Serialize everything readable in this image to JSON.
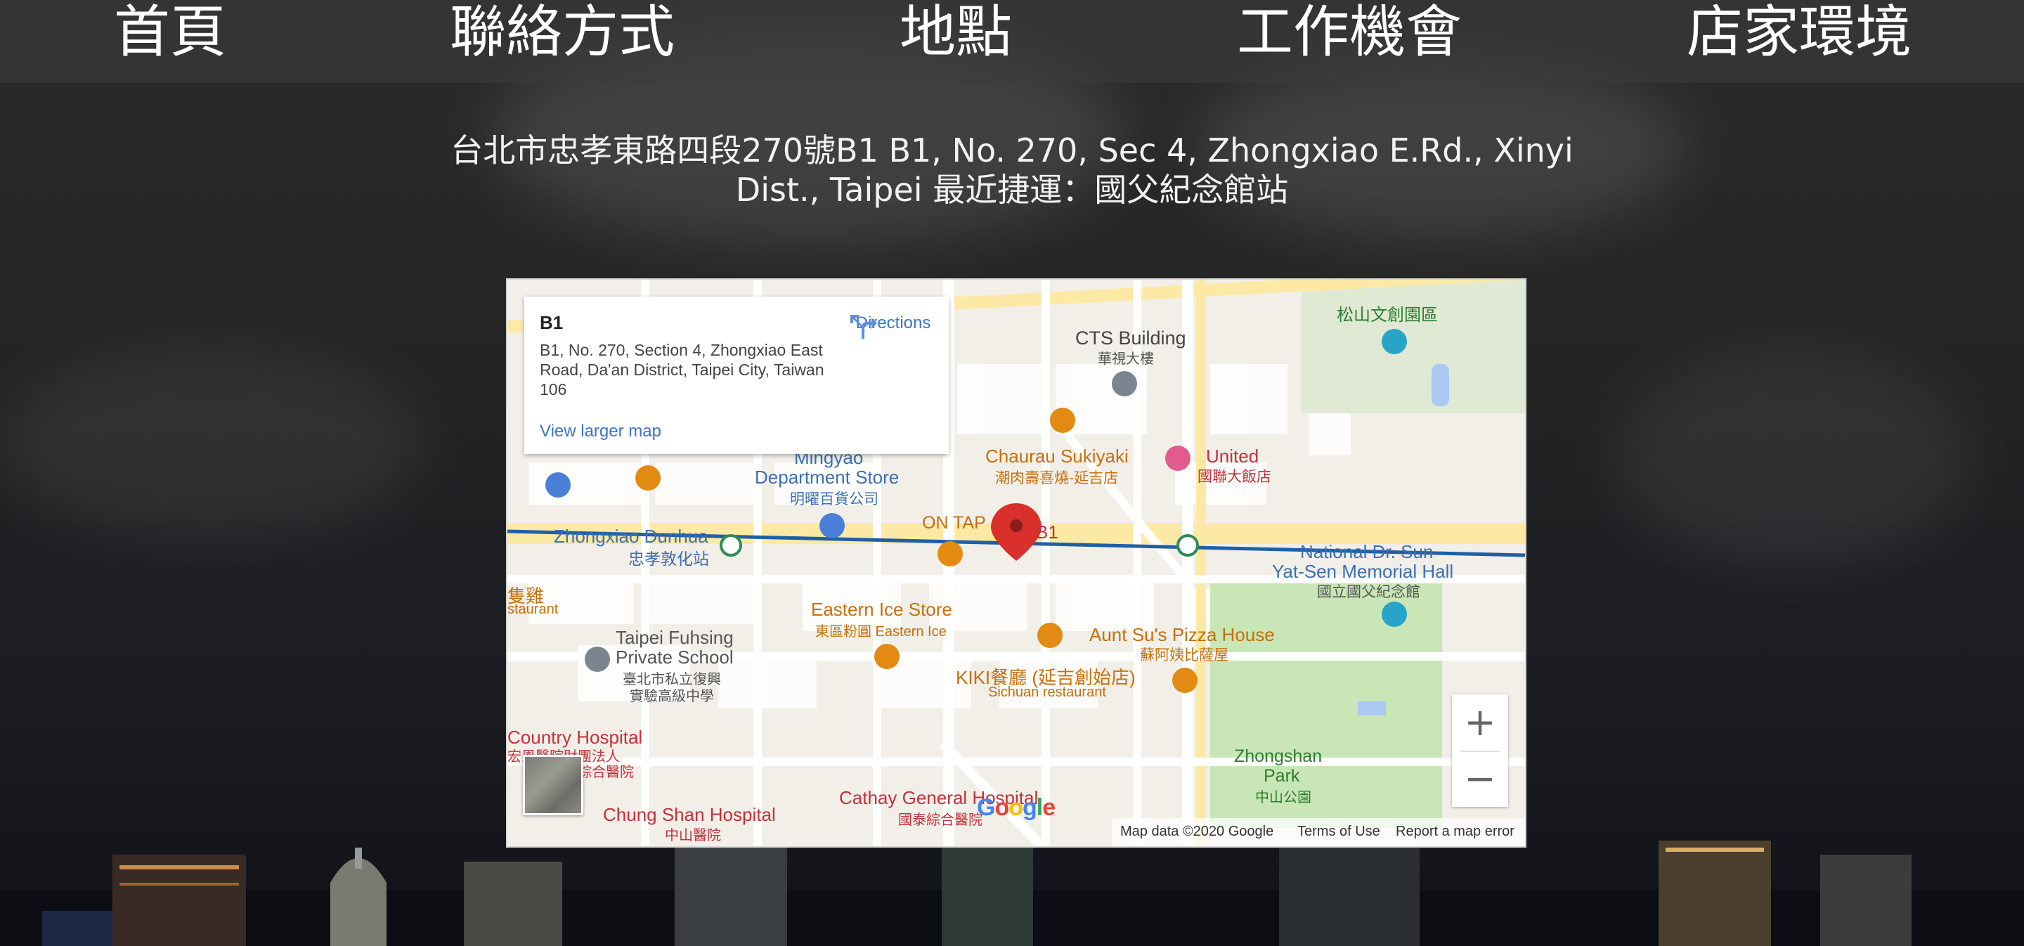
{
  "nav": {
    "items": [
      "首頁",
      "聯絡方式",
      "地點",
      "工作機會",
      "店家環境"
    ]
  },
  "address": {
    "text": "台北市忠孝東路四段270號B1 B1, No. 270, Sec 4, Zhongxiao E.Rd., Xinyi Dist., Taipei 最近捷運：國父紀念館站"
  },
  "map": {
    "info_card": {
      "title": "B1",
      "address": "B1, No. 270, Section 4, Zhongxiao East Road, Da'an District, Taipei City, Taiwan 106",
      "directions_label": "Directions",
      "larger_map_label": "View larger map"
    },
    "marker_label": "B1",
    "places": {
      "cts_en": "CTS Building",
      "cts_zh": "華視大樓",
      "songshan_zh": "松山文創園區",
      "sukiyaki_en": "Chaurau Sukiyaki",
      "sukiyaki_zh": "潮肉壽喜燒-延吉店",
      "united_en": "United",
      "united_zh": "國聯大飯店",
      "mingyao_en1": "Mingyao",
      "mingyao_en2": "Department Store",
      "mingyao_zh": "明曜百貨公司",
      "ontap": "ON TAP",
      "dunhua_en": "Zhongxiao Dunhua",
      "dunhua_zh": "忠孝敦化站",
      "sysmh_en1": "National Dr. Sun",
      "sysmh_en2": "Yat-Sen Memorial Hall",
      "sysmh_zh": "國立國父紀念館",
      "chicken_zh": "隻雞",
      "restaurant": "staurant",
      "ice_en": "Eastern Ice Store",
      "ice_zh": "東區粉圓 Eastern Ice",
      "pizza_en": "Aunt Su's Pizza House",
      "pizza_zh": "蘇阿姨比薩屋",
      "fuhsing_en1": "Taipei Fuhsing",
      "fuhsing_en2": "Private School",
      "fuhsing_zh1": "臺北市私立復興",
      "fuhsing_zh2": "實驗高級中學",
      "kiki_zh": "KIKI餐廳 (延吉創始店)",
      "kiki_en": "Sichuan restaurant",
      "country_hosp": "Country Hospital",
      "country_zh1": "宏恩醫院財團法人",
      "country_zh2": "綜合醫院",
      "zsp_en1": "Zhongshan",
      "zsp_en2": "Park",
      "zsp_zh": "中山公園",
      "chungshan_en": "Chung Shan Hospital",
      "chungshan_zh": "中山醫院",
      "cathay_en": "Cathay General Hospital",
      "cathay_zh": "國泰綜合醫院"
    },
    "zoom_in": "+",
    "zoom_out": "−",
    "logo": "Google",
    "footer": {
      "data": "Map data ©2020 Google",
      "terms": "Terms of Use",
      "report": "Report a map error"
    },
    "colors": {
      "metro_line": "#1f5fa6",
      "marker": "#d9302b",
      "park": "#c8e6b6",
      "road_major": "#fde9a6",
      "poi_orange": "#e38a12",
      "poi_red": "#c5313b"
    }
  }
}
